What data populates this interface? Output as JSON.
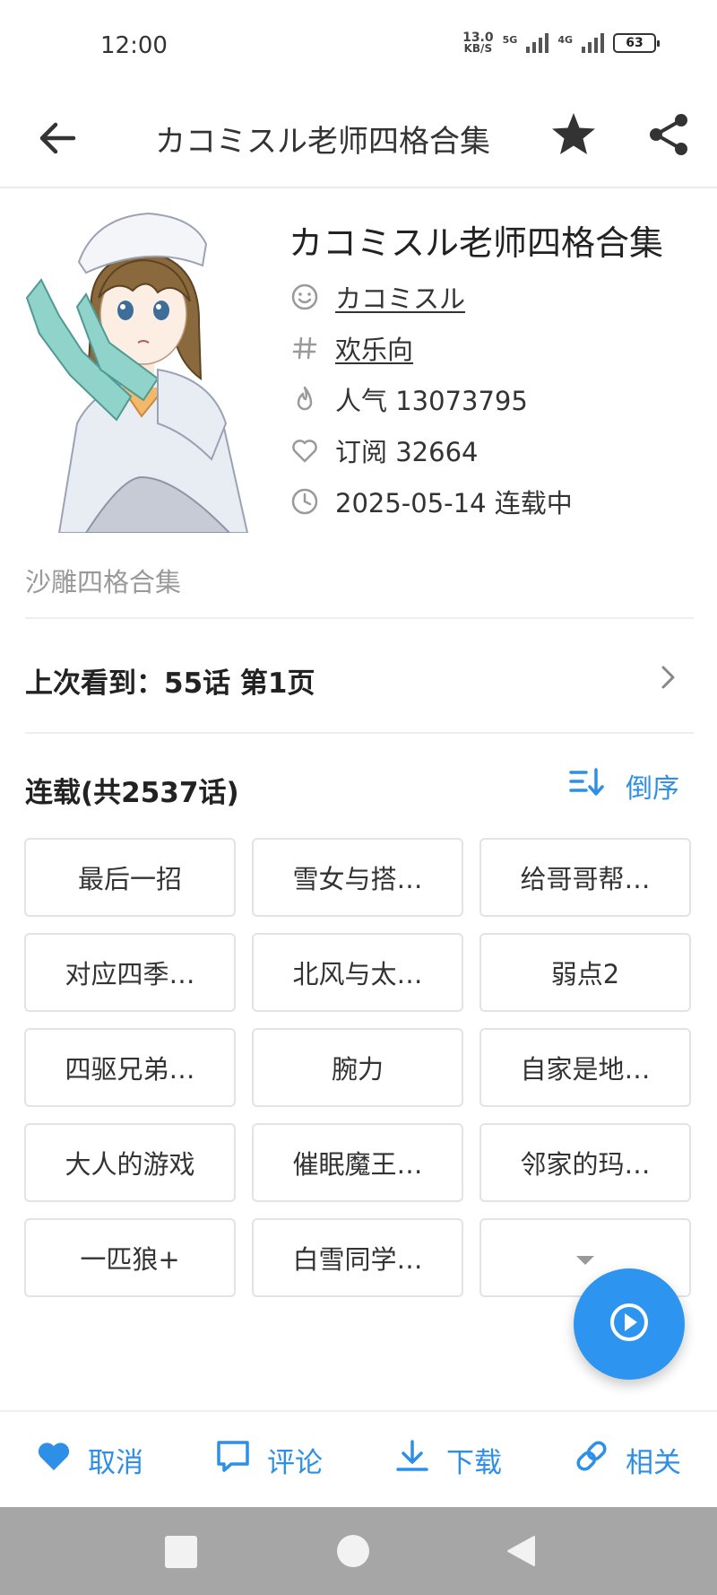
{
  "status_bar": {
    "time": "12:00",
    "net_speed_value": "13.0",
    "net_speed_unit": "KB/S",
    "signal_1_label": "5G",
    "signal_2_label": "4G",
    "battery": "63"
  },
  "top_bar": {
    "title": "カコミスル老师四格合集"
  },
  "comic": {
    "title": "カコミスル老师四格合集",
    "author": "カコミスル",
    "tag": "欢乐向",
    "popularity": "人气 13073795",
    "subscriptions": "订阅 32664",
    "status": "2025-05-14 连载中",
    "summary": "沙雕四格合集"
  },
  "last_read": {
    "label": "上次看到：55话  第1页"
  },
  "chapters": {
    "title": "连载(共2537话)",
    "sort_label": "倒序",
    "items": [
      "最后一招",
      "雪女与搭…",
      "给哥哥帮…",
      "对应四季…",
      "北风与太…",
      "弱点2",
      "四驱兄弟…",
      "腕力",
      "自家是地…",
      "大人的游戏",
      "催眠魔王…",
      "邻家的玛…",
      "一匹狼+",
      "白雪同学…"
    ]
  },
  "bottom_bar": {
    "unfavorite_label": "取消",
    "comment_label": "评论",
    "download_label": "下载",
    "related_label": "相关"
  },
  "colors": {
    "accent": "#2e8fe6",
    "fab": "#2d95ef",
    "nav_bar": "#a6a6a6"
  },
  "icons": {
    "author": "smile-icon",
    "tag": "hash-icon",
    "popularity": "flame-icon",
    "subscriptions": "heart-outline-icon",
    "status": "clock-icon"
  }
}
